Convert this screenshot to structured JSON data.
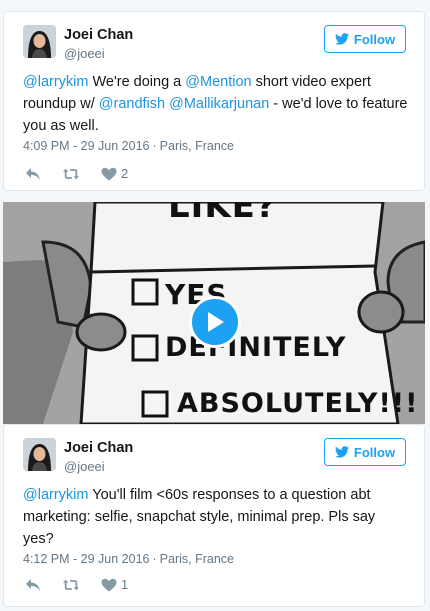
{
  "tweets": [
    {
      "name": "Joei Chan",
      "handle": "@joeei",
      "follow_label": "Follow",
      "text_parts": [
        {
          "t": "@larrykim",
          "m": true
        },
        {
          "t": " We're doing a ",
          "m": false
        },
        {
          "t": "@Mention",
          "m": true
        },
        {
          "t": " short video expert roundup w/ ",
          "m": false
        },
        {
          "t": "@randfish",
          "m": true
        },
        {
          "t": " ",
          "m": false
        },
        {
          "t": "@Mallikarjunan",
          "m": true
        },
        {
          "t": " - we'd love to feature you as well.",
          "m": false
        }
      ],
      "time": "4:09 PM - 29 Jun 2016",
      "location": "Paris, France",
      "likes": "2"
    },
    {
      "name": "Joei Chan",
      "handle": "@joeei",
      "follow_label": "Follow",
      "text_parts": [
        {
          "t": "@larrykim",
          "m": true
        },
        {
          "t": " You'll film <60s responses to a question abt marketing: selfie, snapchat style, minimal prep. Pls say yes?",
          "m": false
        }
      ],
      "time": "4:12 PM - 29 Jun 2016",
      "location": "Paris, France",
      "likes": "1"
    }
  ],
  "video": {
    "heading": "LIKE?",
    "options": [
      "YES",
      "DEFINITELY",
      "ABSOLUTELY!!!"
    ]
  },
  "colors": {
    "accent": "#1da1f2",
    "mention": "#1b95e0",
    "muted": "#657786"
  },
  "icons": [
    "twitter-bird-icon",
    "reply-icon",
    "retweet-icon",
    "heart-icon",
    "play-icon"
  ]
}
